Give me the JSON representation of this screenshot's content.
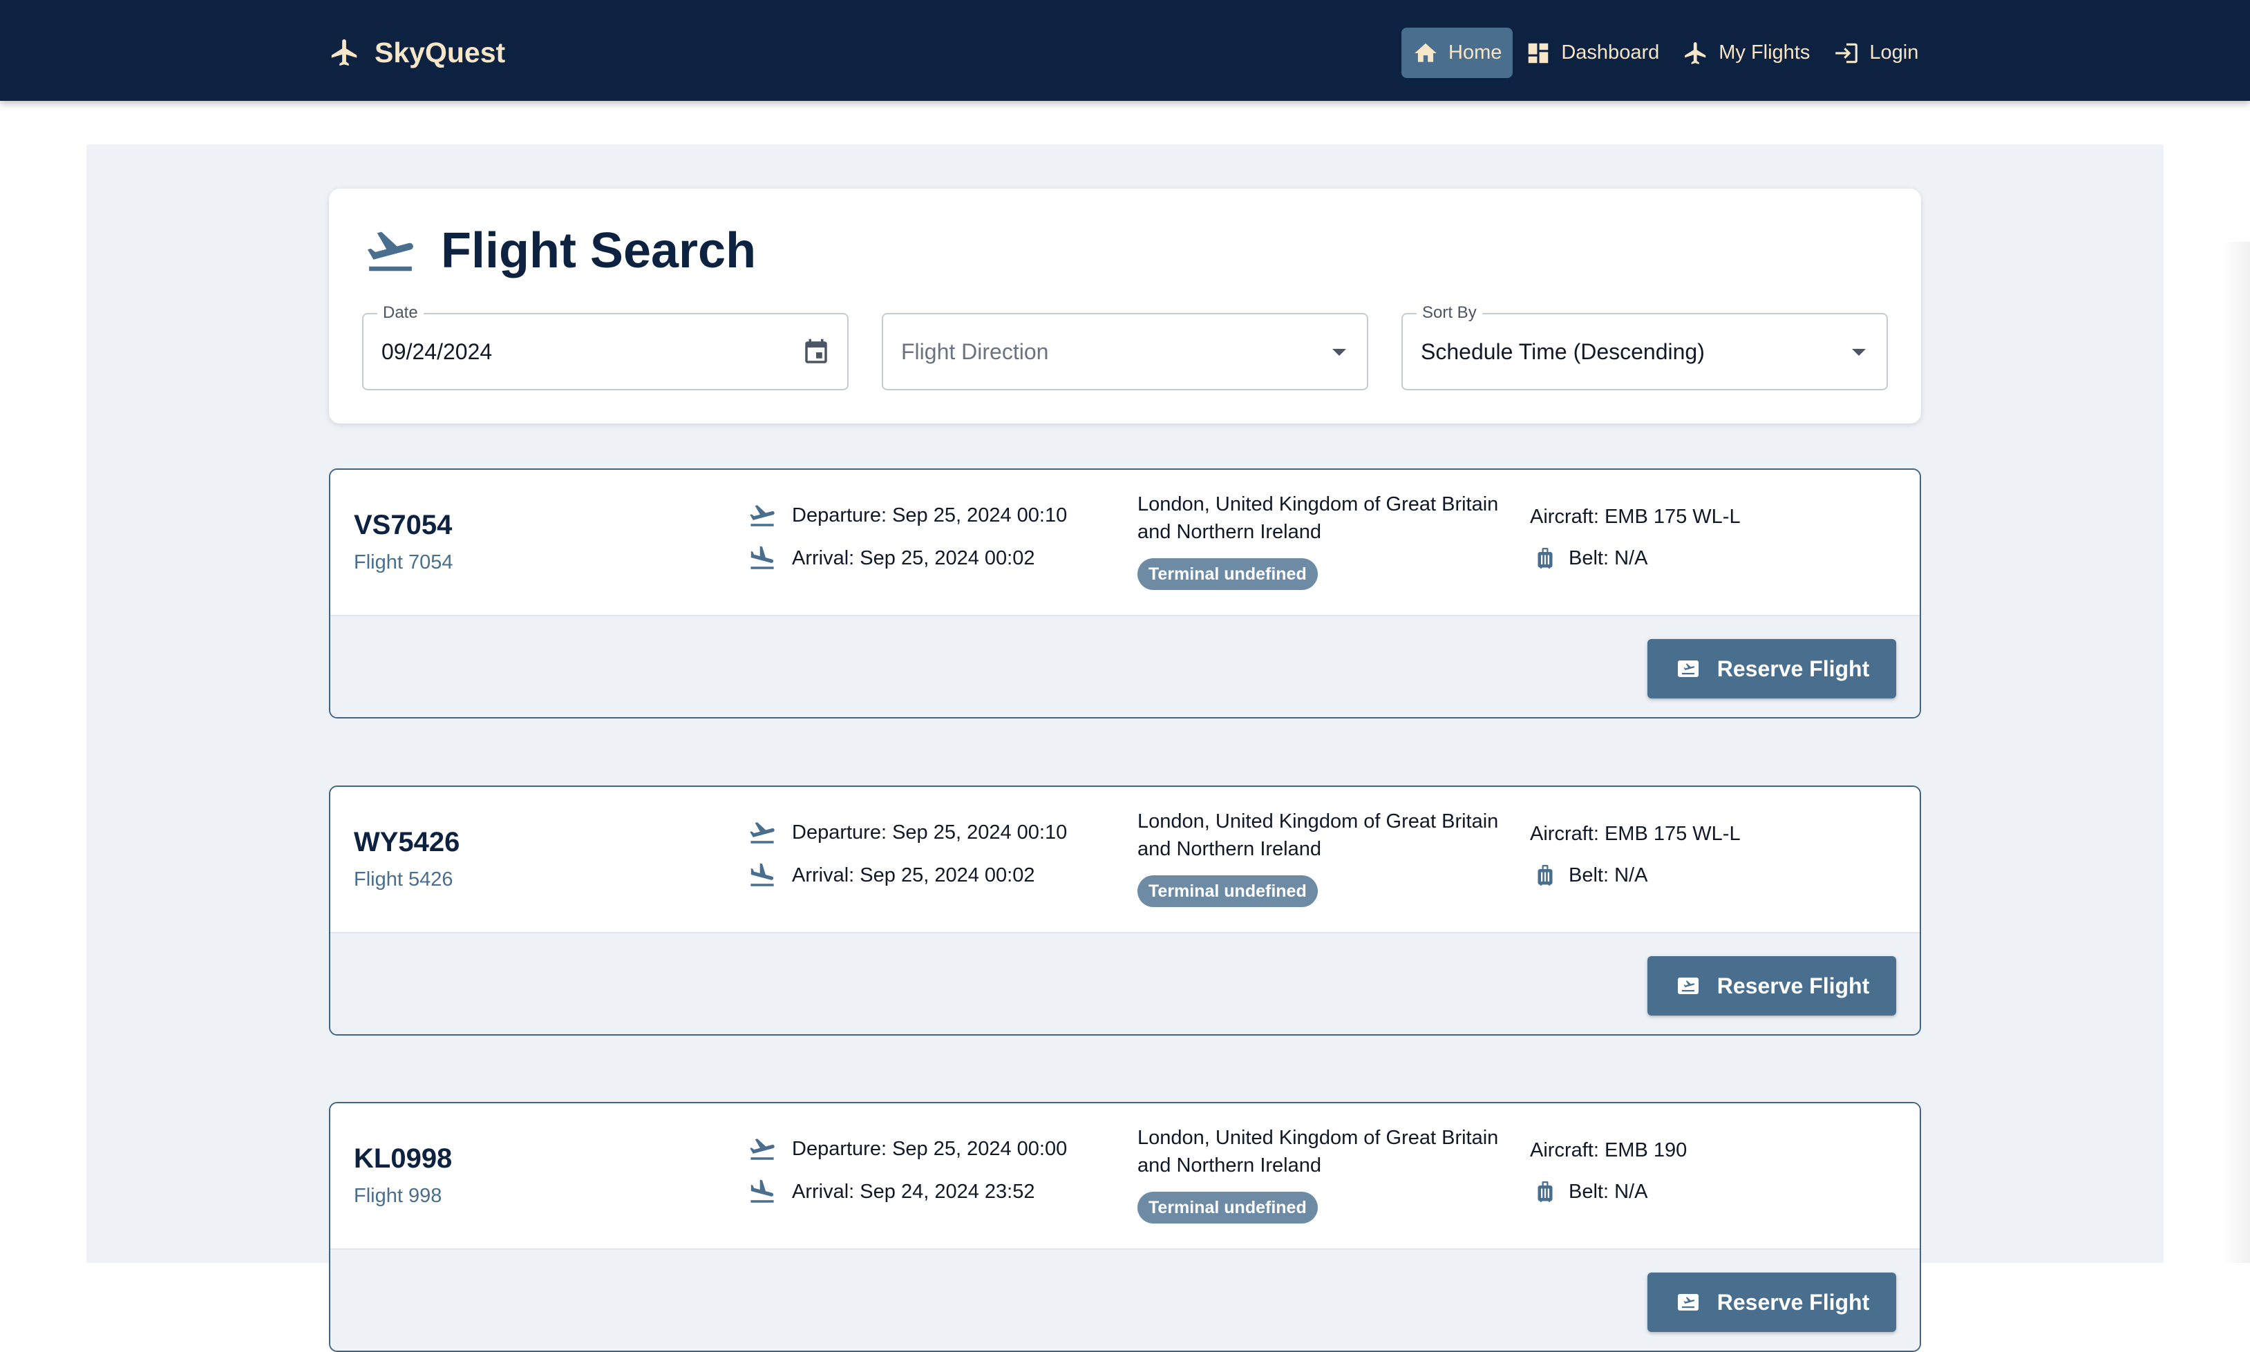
{
  "header": {
    "brand": "SkyQuest",
    "nav": [
      {
        "label": "Home",
        "icon": "home-icon",
        "active": true
      },
      {
        "label": "Dashboard",
        "icon": "dashboard-icon",
        "active": false
      },
      {
        "label": "My Flights",
        "icon": "airplane-icon",
        "active": false
      },
      {
        "label": "Login",
        "icon": "login-icon",
        "active": false
      }
    ]
  },
  "search": {
    "title": "Flight Search",
    "date": {
      "label": "Date",
      "value": "09/24/2024"
    },
    "direction": {
      "placeholder": "Flight Direction"
    },
    "sort": {
      "label": "Sort By",
      "value": "Schedule Time (Descending)"
    }
  },
  "flights": [
    {
      "code": "VS7054",
      "flight_number": "Flight 7054",
      "departure": "Departure: Sep 25, 2024 00:10",
      "arrival": "Arrival: Sep 25, 2024 00:02",
      "destination": "London, United Kingdom of Great Britain and Northern Ireland",
      "terminal": "Terminal undefined",
      "aircraft": "Aircraft: EMB 175 WL-L",
      "belt": "Belt: N/A",
      "reserve_label": "Reserve Flight"
    },
    {
      "code": "WY5426",
      "flight_number": "Flight 5426",
      "departure": "Departure: Sep 25, 2024 00:10",
      "arrival": "Arrival: Sep 25, 2024 00:02",
      "destination": "London, United Kingdom of Great Britain and Northern Ireland",
      "terminal": "Terminal undefined",
      "aircraft": "Aircraft: EMB 175 WL-L",
      "belt": "Belt: N/A",
      "reserve_label": "Reserve Flight"
    },
    {
      "code": "KL0998",
      "flight_number": "Flight 998",
      "departure": "Departure: Sep 25, 2024 00:00",
      "arrival": "Arrival: Sep 24, 2024 23:52",
      "destination": "London, United Kingdom of Great Britain and Northern Ireland",
      "terminal": "Terminal undefined",
      "aircraft": "Aircraft: EMB 190",
      "belt": "Belt: N/A",
      "reserve_label": "Reserve Flight"
    }
  ],
  "colors": {
    "navbar": "#0d2240",
    "accent": "#4a6f8e",
    "brand_text": "#f7e6c8",
    "page_bg": "#eef2f7"
  }
}
